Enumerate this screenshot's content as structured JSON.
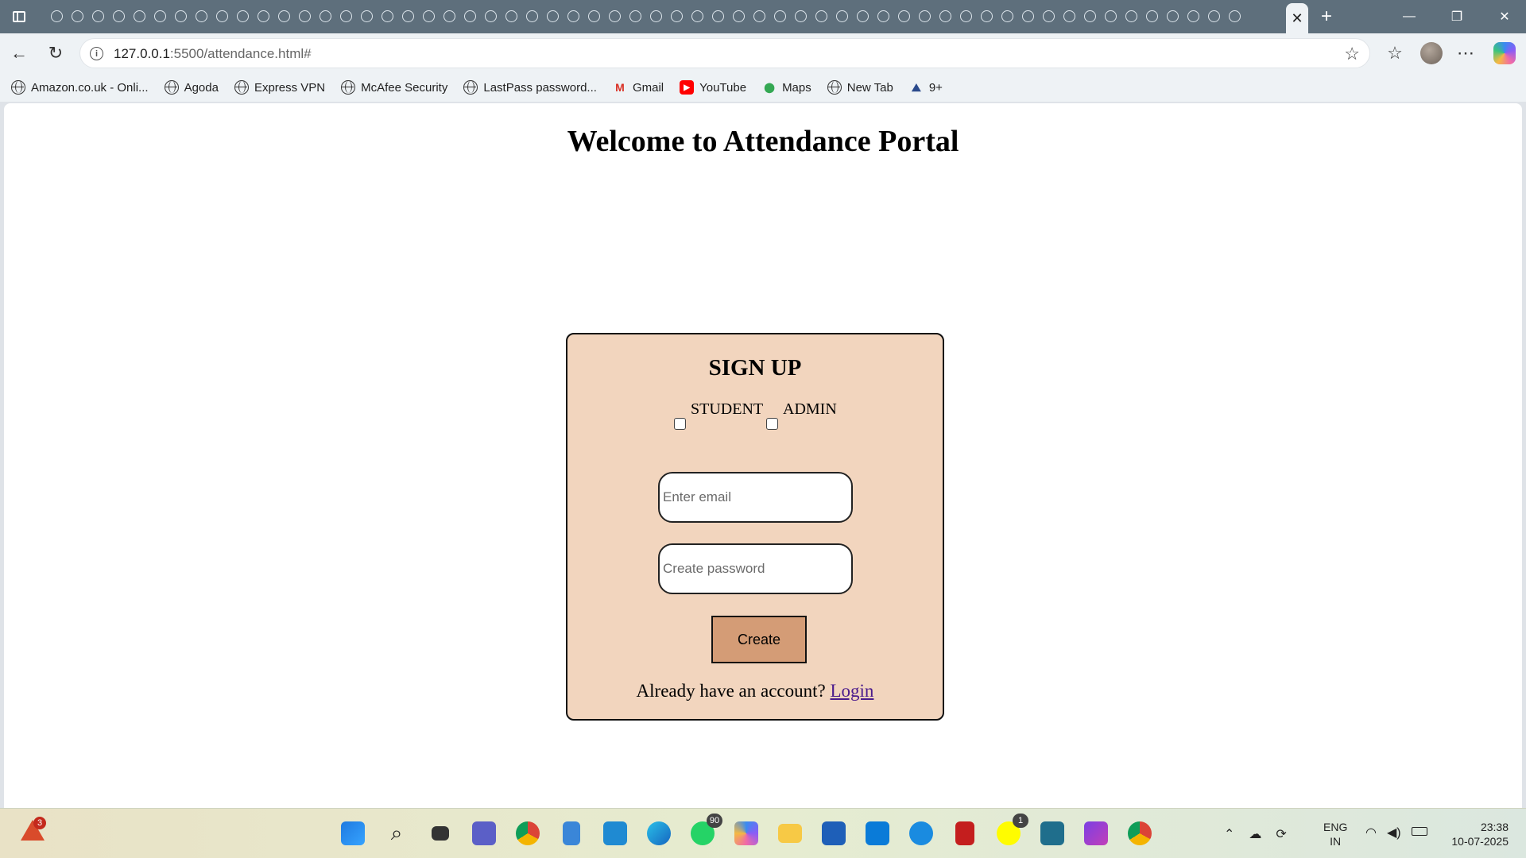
{
  "browser": {
    "url_host": "127.0.0.1",
    "url_path": ":5500/attendance.html#",
    "bookmarks": [
      {
        "label": "Amazon.co.uk - Onli...",
        "icon": "globe-icon"
      },
      {
        "label": "Agoda",
        "icon": "globe-icon"
      },
      {
        "label": "Express VPN",
        "icon": "globe-icon"
      },
      {
        "label": "McAfee Security",
        "icon": "globe-icon"
      },
      {
        "label": "LastPass password...",
        "icon": "globe-icon"
      },
      {
        "label": "Gmail",
        "icon": "gmail-icon"
      },
      {
        "label": "YouTube",
        "icon": "youtube-icon"
      },
      {
        "label": "Maps",
        "icon": "maps-icon"
      },
      {
        "label": "New Tab",
        "icon": "globe-icon"
      },
      {
        "label": "9+",
        "icon": "folder-icon"
      }
    ]
  },
  "page": {
    "title": "Welcome to Attendance Portal",
    "signup": {
      "heading": "SIGN UP",
      "role_student": "STUDENT",
      "role_admin": "ADMIN",
      "email_placeholder": "Enter email",
      "password_placeholder": "Create password",
      "create_label": "Create",
      "login_prompt": "Already have an account?",
      "login_link": "Login"
    }
  },
  "taskbar": {
    "alert_count": "3",
    "whatsapp_count": "90",
    "snapchat_count": "1",
    "lang_line1": "ENG",
    "lang_line2": "IN",
    "time": "23:38",
    "date": "10-07-2025"
  },
  "colors": {
    "card_bg": "#f2d5be",
    "button_bg": "#d49c76",
    "link": "#4b1b8c"
  }
}
